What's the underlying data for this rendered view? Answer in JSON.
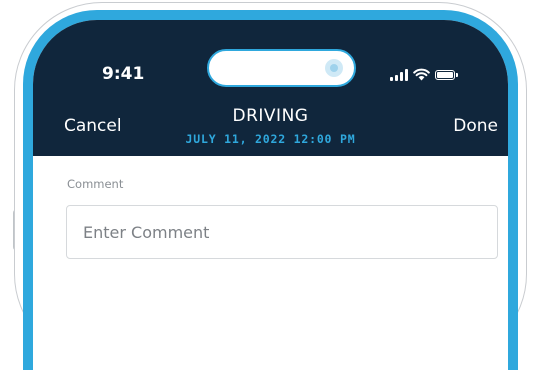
{
  "status_bar": {
    "time": "9:41",
    "icons": [
      "signal-icon",
      "wifi-icon",
      "battery-icon"
    ]
  },
  "header": {
    "cancel_label": "Cancel",
    "title": "DRIVING",
    "subtitle": "JULY 11, 2022 12:00 PM",
    "done_label": "Done"
  },
  "form": {
    "comment_label": "Comment",
    "comment_placeholder": "Enter Comment",
    "comment_value": ""
  },
  "colors": {
    "header_bg": "#10263c",
    "accent": "#2fa8dd",
    "frame": "#2fa8dd",
    "text_on_header": "#ffffff"
  }
}
